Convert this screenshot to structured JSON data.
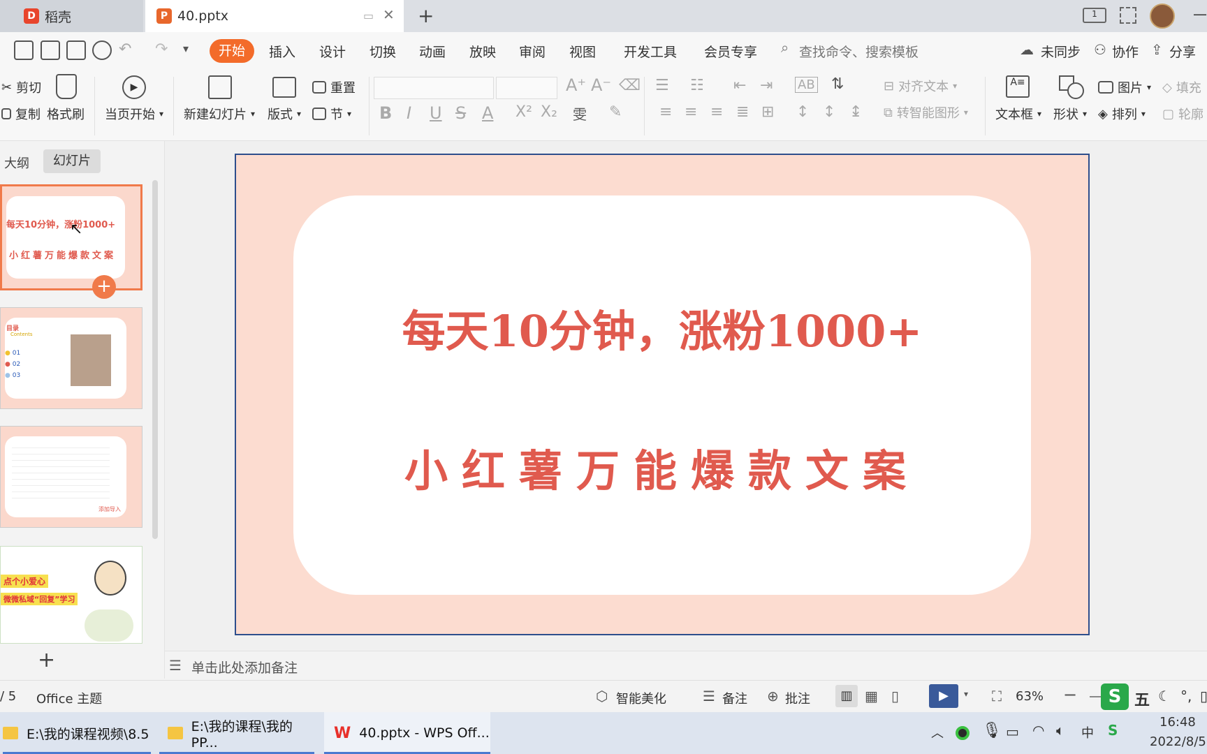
{
  "tabs": [
    {
      "label": "稻壳",
      "icon": "daoke-logo-icon",
      "color": "#e8452c"
    },
    {
      "label": "40.pptx",
      "icon": "pptx-file-icon",
      "color": "#e8672c"
    }
  ],
  "menu": {
    "items": [
      "开始",
      "插入",
      "设计",
      "切换",
      "动画",
      "放映",
      "审阅",
      "视图",
      "开发工具",
      "会员专享"
    ],
    "active_color": "#f36b2a",
    "search_placeholder": "查找命令、搜索模板",
    "sync": "未同步",
    "collab": "协作",
    "share": "分享"
  },
  "ribbon": {
    "cut": "剪切",
    "copy": "复制",
    "format_painter": "格式刷",
    "play_from_current": "当页开始",
    "new_slide": "新建幻灯片",
    "layout": "版式",
    "reset": "重置",
    "section": "节",
    "align_text": "对齐文本",
    "smart_art": "转智能图形",
    "text_box": "文本框",
    "shape": "形状",
    "picture": "图片",
    "arrange": "排列",
    "fill": "填充",
    "outline": "轮廓"
  },
  "left_panel": {
    "tab_outline": "大纲",
    "tab_slides": "幻灯片",
    "thumb1_line1": "每天10分钟，涨粉1000+",
    "thumb1_line2": "小红薯万能爆款文案",
    "thumb2_title": "目录",
    "thumb2_sub": "Contents",
    "thumb2_items": [
      "01",
      "02",
      "03"
    ],
    "thumb3_footer": "添加导入",
    "thumb4_line1": "点个小爱心",
    "thumb4_line2": "微微私域“回复”学习"
  },
  "slide": {
    "title": "每天10分钟，涨粉1000+",
    "subtitle": "小红薯万能爆款文案",
    "text_color": "#e05a4e",
    "bg_color": "#fcdcd0"
  },
  "notes_placeholder": "单击此处添加备注",
  "status": {
    "page": "/ 5",
    "theme": "Office 主题",
    "beautify": "智能美化",
    "notes": "备注",
    "comments": "批注",
    "zoom": "63%"
  },
  "taskbar": {
    "items": [
      "E:\\我的课程视频\\8.5",
      "E:\\我的课程\\我的PP...",
      "40.pptx - WPS Off..."
    ],
    "time": "16:48",
    "date": "2022/8/5",
    "ime": "中",
    "ime_mode": "五"
  }
}
